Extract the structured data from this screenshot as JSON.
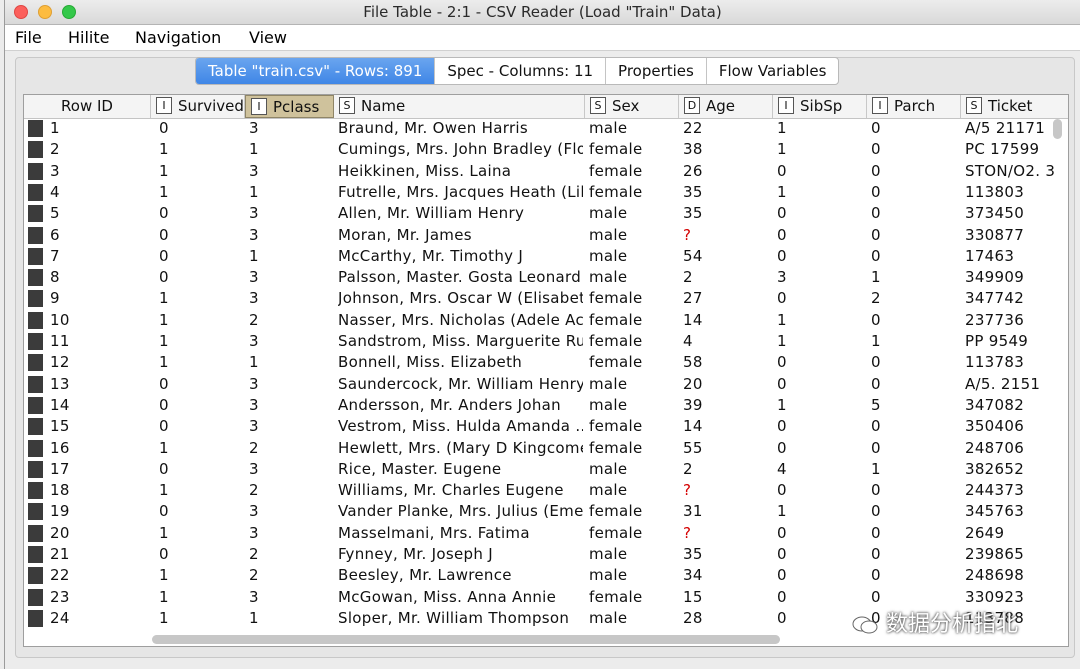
{
  "window": {
    "title": "File Table - 2:1 - CSV Reader (Load \"Train\" Data)"
  },
  "menu": [
    "File",
    "Hilite",
    "Navigation",
    "View"
  ],
  "tabs": [
    {
      "label": "Table \"train.csv\" - Rows: 891",
      "active": true
    },
    {
      "label": "Spec - Columns: 11",
      "active": false
    },
    {
      "label": "Properties",
      "active": false
    },
    {
      "label": "Flow Variables",
      "active": false
    }
  ],
  "columns": [
    {
      "key": "rowid",
      "name": "Row ID",
      "type": ""
    },
    {
      "key": "survived",
      "name": "Survived",
      "type": "I"
    },
    {
      "key": "pclass",
      "name": "Pclass",
      "type": "I",
      "selected": true
    },
    {
      "key": "name",
      "name": "Name",
      "type": "S"
    },
    {
      "key": "sex",
      "name": "Sex",
      "type": "S"
    },
    {
      "key": "age",
      "name": "Age",
      "type": "D"
    },
    {
      "key": "sibsp",
      "name": "SibSp",
      "type": "I"
    },
    {
      "key": "parch",
      "name": "Parch",
      "type": "I"
    },
    {
      "key": "ticket",
      "name": "Ticket",
      "type": "S"
    }
  ],
  "missing_marker": "?",
  "missing_color": "#d40000",
  "rows": [
    [
      "1",
      "0",
      "3",
      "Braund, Mr. Owen Harris",
      "male",
      "22",
      "1",
      "0",
      "A/5 21171"
    ],
    [
      "2",
      "1",
      "1",
      "Cumings, Mrs. John Bradley (Flo...",
      "female",
      "38",
      "1",
      "0",
      "PC 17599"
    ],
    [
      "3",
      "1",
      "3",
      "Heikkinen, Miss. Laina",
      "female",
      "26",
      "0",
      "0",
      "STON/O2. 3"
    ],
    [
      "4",
      "1",
      "1",
      "Futrelle, Mrs. Jacques Heath (Lil...",
      "female",
      "35",
      "1",
      "0",
      "113803"
    ],
    [
      "5",
      "0",
      "3",
      "Allen, Mr. William Henry",
      "male",
      "35",
      "0",
      "0",
      "373450"
    ],
    [
      "6",
      "0",
      "3",
      "Moran, Mr. James",
      "male",
      "?",
      "0",
      "0",
      "330877"
    ],
    [
      "7",
      "0",
      "1",
      "McCarthy, Mr. Timothy J",
      "male",
      "54",
      "0",
      "0",
      "17463"
    ],
    [
      "8",
      "0",
      "3",
      "Palsson, Master. Gosta Leonard",
      "male",
      "2",
      "3",
      "1",
      "349909"
    ],
    [
      "9",
      "1",
      "3",
      "Johnson, Mrs. Oscar W (Elisabet...",
      "female",
      "27",
      "0",
      "2",
      "347742"
    ],
    [
      "10",
      "1",
      "2",
      "Nasser, Mrs. Nicholas (Adele Ac...",
      "female",
      "14",
      "1",
      "0",
      "237736"
    ],
    [
      "11",
      "1",
      "3",
      "Sandstrom, Miss. Marguerite Rut",
      "female",
      "4",
      "1",
      "1",
      "PP 9549"
    ],
    [
      "12",
      "1",
      "1",
      "Bonnell, Miss. Elizabeth",
      "female",
      "58",
      "0",
      "0",
      "113783"
    ],
    [
      "13",
      "0",
      "3",
      "Saundercock, Mr. William Henry",
      "male",
      "20",
      "0",
      "0",
      "A/5. 2151"
    ],
    [
      "14",
      "0",
      "3",
      "Andersson, Mr. Anders Johan",
      "male",
      "39",
      "1",
      "5",
      "347082"
    ],
    [
      "15",
      "0",
      "3",
      "Vestrom, Miss. Hulda Amanda ...",
      "female",
      "14",
      "0",
      "0",
      "350406"
    ],
    [
      "16",
      "1",
      "2",
      "Hewlett, Mrs. (Mary D Kingcome)",
      "female",
      "55",
      "0",
      "0",
      "248706"
    ],
    [
      "17",
      "0",
      "3",
      "Rice, Master. Eugene",
      "male",
      "2",
      "4",
      "1",
      "382652"
    ],
    [
      "18",
      "1",
      "2",
      "Williams, Mr. Charles Eugene",
      "male",
      "?",
      "0",
      "0",
      "244373"
    ],
    [
      "19",
      "0",
      "3",
      "Vander Planke, Mrs. Julius (Eme...",
      "female",
      "31",
      "1",
      "0",
      "345763"
    ],
    [
      "20",
      "1",
      "3",
      "Masselmani, Mrs. Fatima",
      "female",
      "?",
      "0",
      "0",
      "2649"
    ],
    [
      "21",
      "0",
      "2",
      "Fynney, Mr. Joseph J",
      "male",
      "35",
      "0",
      "0",
      "239865"
    ],
    [
      "22",
      "1",
      "2",
      "Beesley, Mr. Lawrence",
      "male",
      "34",
      "0",
      "0",
      "248698"
    ],
    [
      "23",
      "1",
      "3",
      "McGowan, Miss. Anna Annie",
      "female",
      "15",
      "0",
      "0",
      "330923"
    ],
    [
      "24",
      "1",
      "1",
      "Sloper, Mr. William Thompson",
      "male",
      "28",
      "0",
      "0",
      "113788"
    ]
  ],
  "watermark": "数据分析指北",
  "colors": {
    "active_tab": "#3f86e6",
    "selected_header": "#cfc29c",
    "row_marker": "#3b3b3b"
  }
}
